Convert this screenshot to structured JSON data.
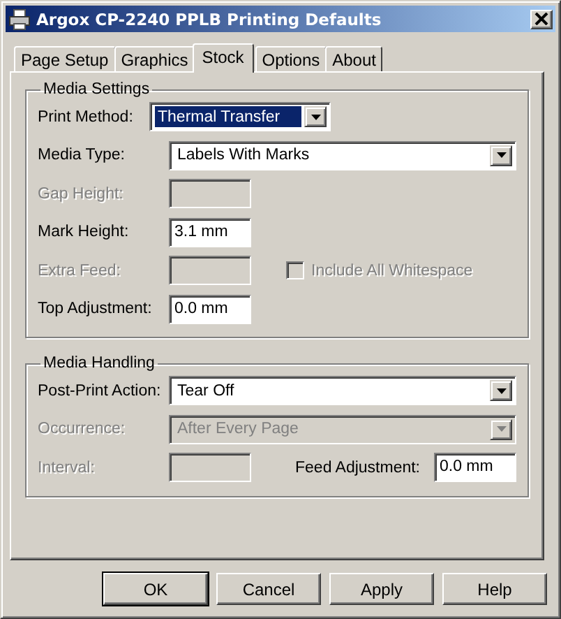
{
  "window": {
    "title": "Argox CP-2240 PPLB Printing Defaults"
  },
  "tabs": [
    {
      "label": "Page Setup",
      "selected": false
    },
    {
      "label": "Graphics",
      "selected": false
    },
    {
      "label": "Stock",
      "selected": true
    },
    {
      "label": "Options",
      "selected": false
    },
    {
      "label": "About",
      "selected": false
    }
  ],
  "groups": [
    {
      "title": "Media Settings",
      "rows": [
        {
          "label": "Print Method:",
          "kind": "combo",
          "value": "Thermal Transfer",
          "disabled": false,
          "focused": true
        },
        {
          "label": "Media Type:",
          "kind": "dropdown",
          "value": "Labels With Marks",
          "disabled": false,
          "focused": false
        },
        {
          "label": "Gap Height:",
          "kind": "text",
          "disabled": true
        },
        {
          "label": "Mark Height:",
          "kind": "text",
          "value": "3.1 mm",
          "disabled": false
        },
        {
          "label": "Extra Feed:",
          "kind": "text",
          "disabled": true,
          "aside": {
            "kind": "checkbox",
            "label": "Include All Whitespace",
            "checked": false,
            "disabled": true
          }
        },
        {
          "label": "Top Adjustment:",
          "kind": "text",
          "value": "0.0 mm",
          "disabled": false
        }
      ]
    },
    {
      "title": "Media Handling",
      "rows": [
        {
          "label": "Post-Print Action:",
          "kind": "dropdown",
          "value": "Tear Off",
          "disabled": false,
          "focused": false
        },
        {
          "label": "Occurrence:",
          "kind": "dropdown",
          "value": "After Every Page",
          "disabled": true,
          "focused": false
        },
        {
          "label": "Interval:",
          "kind": "text",
          "disabled": true,
          "aside": {
            "kind": "text",
            "label": "Feed Adjustment:",
            "value": "0.0 mm",
            "disabled": false
          }
        }
      ]
    }
  ],
  "buttons": [
    {
      "label": "OK",
      "default": true
    },
    {
      "label": "Cancel",
      "default": false
    },
    {
      "label": "Apply",
      "default": false
    },
    {
      "label": "Help",
      "default": false
    }
  ]
}
